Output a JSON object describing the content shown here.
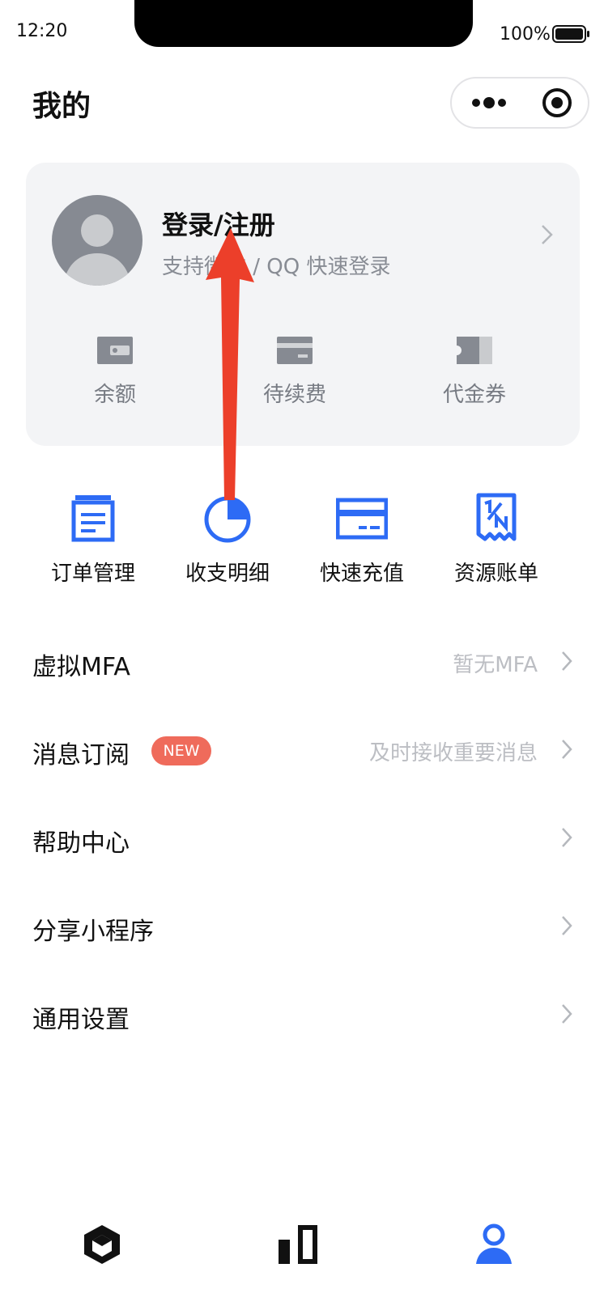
{
  "status_bar": {
    "time": "12:20",
    "battery": "100%"
  },
  "header": {
    "title": "我的",
    "capsule_more_icon": "more-dots-icon",
    "capsule_close_icon": "target-icon"
  },
  "login_card": {
    "title": "登录/注册",
    "subtitle": "支持微信 / QQ 快速登录",
    "wallet": [
      {
        "label": "余额",
        "icon": "wallet-icon"
      },
      {
        "label": "待续费",
        "icon": "card-icon"
      },
      {
        "label": "代金券",
        "icon": "voucher-icon"
      }
    ]
  },
  "quick_actions": [
    {
      "label": "订单管理",
      "icon": "order-icon"
    },
    {
      "label": "收支明细",
      "icon": "pie-chart-icon"
    },
    {
      "label": "快速充值",
      "icon": "credit-card-icon"
    },
    {
      "label": "资源账单",
      "icon": "bill-icon"
    }
  ],
  "menu": [
    {
      "label": "虚拟MFA",
      "value": "暂无MFA"
    },
    {
      "label": "消息订阅",
      "badge": "NEW",
      "value": "及时接收重要消息"
    },
    {
      "label": "帮助中心",
      "value": ""
    },
    {
      "label": "分享小程序",
      "value": ""
    },
    {
      "label": "通用设置",
      "value": ""
    }
  ],
  "tab_bar": [
    {
      "icon": "cube-icon",
      "active": false
    },
    {
      "icon": "bar-chart-icon",
      "active": false
    },
    {
      "icon": "user-icon",
      "active": true
    }
  ],
  "colors": {
    "accent": "#2d6bf5",
    "badge": "#ef6b5b",
    "arrow": "#ec3f2a"
  }
}
